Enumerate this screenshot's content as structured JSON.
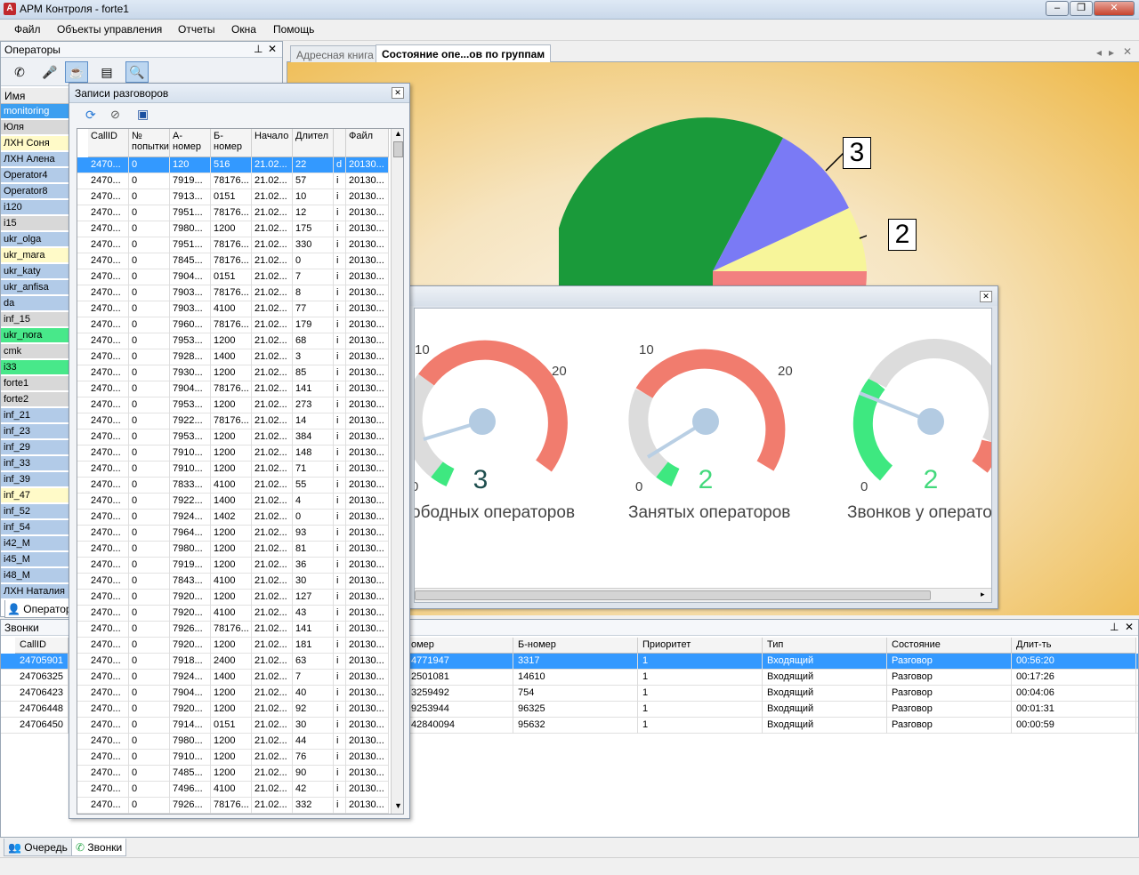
{
  "app": {
    "title": "АРМ Контроля - forte1"
  },
  "menu": [
    "Файл",
    "Объекты управления",
    "Отчеты",
    "Окна",
    "Помощь"
  ],
  "operators": {
    "panel_title": "Операторы",
    "col_name": "Имя",
    "tab_label": "Операторы",
    "items": [
      {
        "name": "monitoring",
        "color": "#3d9ff0"
      },
      {
        "name": "Юля",
        "color": "#d8d8d8"
      },
      {
        "name": "ЛХН Соня",
        "color": "#fffac8"
      },
      {
        "name": "ЛХН Алена",
        "color": "#b2cbe8"
      },
      {
        "name": "Operator4",
        "color": "#b2cbe8"
      },
      {
        "name": "Operator8",
        "color": "#b2cbe8"
      },
      {
        "name": "i120",
        "color": "#b2cbe8"
      },
      {
        "name": "i15",
        "color": "#d8d8d8"
      },
      {
        "name": "ukr_olga",
        "color": "#b2cbe8"
      },
      {
        "name": "ukr_mara",
        "color": "#fffac8"
      },
      {
        "name": "ukr_katy",
        "color": "#b2cbe8"
      },
      {
        "name": "ukr_anfisa",
        "color": "#b2cbe8"
      },
      {
        "name": "da",
        "color": "#b2cbe8"
      },
      {
        "name": "inf_15",
        "color": "#d8d8d8"
      },
      {
        "name": "ukr_nora",
        "color": "#48e88a"
      },
      {
        "name": "cmk",
        "color": "#d8d8d8"
      },
      {
        "name": "i33",
        "color": "#48e88a"
      },
      {
        "name": "forte1",
        "color": "#d8d8d8"
      },
      {
        "name": "forte2",
        "color": "#d8d8d8"
      },
      {
        "name": "inf_21",
        "color": "#b2cbe8"
      },
      {
        "name": "inf_23",
        "color": "#b2cbe8"
      },
      {
        "name": "inf_29",
        "color": "#b2cbe8"
      },
      {
        "name": "inf_33",
        "color": "#b2cbe8"
      },
      {
        "name": "inf_39",
        "color": "#b2cbe8"
      },
      {
        "name": "inf_47",
        "color": "#fffac8"
      },
      {
        "name": "inf_52",
        "color": "#b2cbe8"
      },
      {
        "name": "inf_54",
        "color": "#b2cbe8"
      },
      {
        "name": "i42_M",
        "color": "#b2cbe8"
      },
      {
        "name": "i45_M",
        "color": "#b2cbe8"
      },
      {
        "name": "i48_M",
        "color": "#b2cbe8"
      },
      {
        "name": "ЛХН Наталия",
        "color": "#b2cbe8"
      }
    ]
  },
  "records": {
    "title": "Записи разговоров",
    "columns": [
      "CallID",
      "№ попытки",
      "А-номер",
      "Б-номер",
      "Начало",
      "Длител",
      "",
      "Файл"
    ],
    "rows": [
      [
        "2470...",
        "0",
        "120",
        "516",
        "21.02...",
        "22",
        "d",
        "20130..."
      ],
      [
        "2470...",
        "0",
        "7919...",
        "78176...",
        "21.02...",
        "57",
        "i",
        "20130..."
      ],
      [
        "2470...",
        "0",
        "7913...",
        "0151",
        "21.02...",
        "10",
        "i",
        "20130..."
      ],
      [
        "2470...",
        "0",
        "7951...",
        "78176...",
        "21.02...",
        "12",
        "i",
        "20130..."
      ],
      [
        "2470...",
        "0",
        "7980...",
        "1200",
        "21.02...",
        "175",
        "i",
        "20130..."
      ],
      [
        "2470...",
        "0",
        "7951...",
        "78176...",
        "21.02...",
        "330",
        "i",
        "20130..."
      ],
      [
        "2470...",
        "0",
        "7845...",
        "78176...",
        "21.02...",
        "0",
        "i",
        "20130..."
      ],
      [
        "2470...",
        "0",
        "7904...",
        "0151",
        "21.02...",
        "7",
        "i",
        "20130..."
      ],
      [
        "2470...",
        "0",
        "7903...",
        "78176...",
        "21.02...",
        "8",
        "i",
        "20130..."
      ],
      [
        "2470...",
        "0",
        "7903...",
        "4100",
        "21.02...",
        "77",
        "i",
        "20130..."
      ],
      [
        "2470...",
        "0",
        "7960...",
        "78176...",
        "21.02...",
        "179",
        "i",
        "20130..."
      ],
      [
        "2470...",
        "0",
        "7953...",
        "1200",
        "21.02...",
        "68",
        "i",
        "20130..."
      ],
      [
        "2470...",
        "0",
        "7928...",
        "1400",
        "21.02...",
        "3",
        "i",
        "20130..."
      ],
      [
        "2470...",
        "0",
        "7930...",
        "1200",
        "21.02...",
        "85",
        "i",
        "20130..."
      ],
      [
        "2470...",
        "0",
        "7904...",
        "78176...",
        "21.02...",
        "141",
        "i",
        "20130..."
      ],
      [
        "2470...",
        "0",
        "7953...",
        "1200",
        "21.02...",
        "273",
        "i",
        "20130..."
      ],
      [
        "2470...",
        "0",
        "7922...",
        "78176...",
        "21.02...",
        "14",
        "i",
        "20130..."
      ],
      [
        "2470...",
        "0",
        "7953...",
        "1200",
        "21.02...",
        "384",
        "i",
        "20130..."
      ],
      [
        "2470...",
        "0",
        "7910...",
        "1200",
        "21.02...",
        "148",
        "i",
        "20130..."
      ],
      [
        "2470...",
        "0",
        "7910...",
        "1200",
        "21.02...",
        "71",
        "i",
        "20130..."
      ],
      [
        "2470...",
        "0",
        "7833...",
        "4100",
        "21.02...",
        "55",
        "i",
        "20130..."
      ],
      [
        "2470...",
        "0",
        "7922...",
        "1400",
        "21.02...",
        "4",
        "i",
        "20130..."
      ],
      [
        "2470...",
        "0",
        "7924...",
        "1402",
        "21.02...",
        "0",
        "i",
        "20130..."
      ],
      [
        "2470...",
        "0",
        "7964...",
        "1200",
        "21.02...",
        "93",
        "i",
        "20130..."
      ],
      [
        "2470...",
        "0",
        "7980...",
        "1200",
        "21.02...",
        "81",
        "i",
        "20130..."
      ],
      [
        "2470...",
        "0",
        "7919...",
        "1200",
        "21.02...",
        "36",
        "i",
        "20130..."
      ],
      [
        "2470...",
        "0",
        "7843...",
        "4100",
        "21.02...",
        "30",
        "i",
        "20130..."
      ],
      [
        "2470...",
        "0",
        "7920...",
        "1200",
        "21.02...",
        "127",
        "i",
        "20130..."
      ],
      [
        "2470...",
        "0",
        "7920...",
        "4100",
        "21.02...",
        "43",
        "i",
        "20130..."
      ],
      [
        "2470...",
        "0",
        "7926...",
        "78176...",
        "21.02...",
        "141",
        "i",
        "20130..."
      ],
      [
        "2470...",
        "0",
        "7920...",
        "1200",
        "21.02...",
        "181",
        "i",
        "20130..."
      ],
      [
        "2470...",
        "0",
        "7918...",
        "2400",
        "21.02...",
        "63",
        "i",
        "20130..."
      ],
      [
        "2470...",
        "0",
        "7924...",
        "1400",
        "21.02...",
        "7",
        "i",
        "20130..."
      ],
      [
        "2470...",
        "0",
        "7904...",
        "1200",
        "21.02...",
        "40",
        "i",
        "20130..."
      ],
      [
        "2470...",
        "0",
        "7920...",
        "1200",
        "21.02...",
        "92",
        "i",
        "20130..."
      ],
      [
        "2470...",
        "0",
        "7914...",
        "0151",
        "21.02...",
        "30",
        "i",
        "20130..."
      ],
      [
        "2470...",
        "0",
        "7980...",
        "1200",
        "21.02...",
        "44",
        "i",
        "20130..."
      ],
      [
        "2470...",
        "0",
        "7910...",
        "1200",
        "21.02...",
        "76",
        "i",
        "20130..."
      ],
      [
        "2470...",
        "0",
        "7485...",
        "1200",
        "21.02...",
        "90",
        "i",
        "20130..."
      ],
      [
        "2470...",
        "0",
        "7496...",
        "4100",
        "21.02...",
        "42",
        "i",
        "20130..."
      ],
      [
        "2470...",
        "0",
        "7926...",
        "78176...",
        "21.02...",
        "332",
        "i",
        "20130..."
      ]
    ]
  },
  "doc_tabs": [
    "Адресная книга",
    "Состояние опе...ов по группам"
  ],
  "pie": {
    "label_a": "3",
    "label_b": "2",
    "colors": [
      "#1a9a3a",
      "#7a7af5",
      "#f7f59a",
      "#f28080"
    ]
  },
  "gauges": [
    {
      "value": "3",
      "caption": "ободных операторов",
      "tick_lo": "0",
      "tick_mid": "10",
      "tick_hi": "20",
      "value_color": "#1f4f4f"
    },
    {
      "value": "2",
      "caption": "Занятых операторов",
      "tick_lo": "0",
      "tick_mid": "10",
      "tick_hi": "20",
      "value_color": "#43d97c"
    },
    {
      "value": "2",
      "caption": "Звонков у операто",
      "tick_lo": "0",
      "tick_mid": "",
      "tick_hi": "",
      "value_color": "#43d97c"
    }
  ],
  "calls": {
    "panel_title": "Звонки",
    "columns": [
      "CallID",
      "омер",
      "Б-номер",
      "Приоритет",
      "Тип",
      "Состояние",
      "Длит-ть"
    ],
    "rows": [
      [
        "24705901",
        "4771947",
        "3317",
        "1",
        "Входящий",
        "Разговор",
        "00:56:20"
      ],
      [
        "24706325",
        "2501081",
        "14610",
        "1",
        "Входящий",
        "Разговор",
        "00:17:26"
      ],
      [
        "24706423",
        "3259492",
        "754",
        "1",
        "Входящий",
        "Разговор",
        "00:04:06"
      ],
      [
        "24706448",
        "9253944",
        "96325",
        "1",
        "Входящий",
        "Разговор",
        "00:01:31"
      ],
      [
        "24706450",
        "42840094",
        "95632",
        "1",
        "Входящий",
        "Разговор",
        "00:00:59"
      ]
    ]
  },
  "bottom_tabs": [
    "Очередь",
    "Звонки"
  ]
}
